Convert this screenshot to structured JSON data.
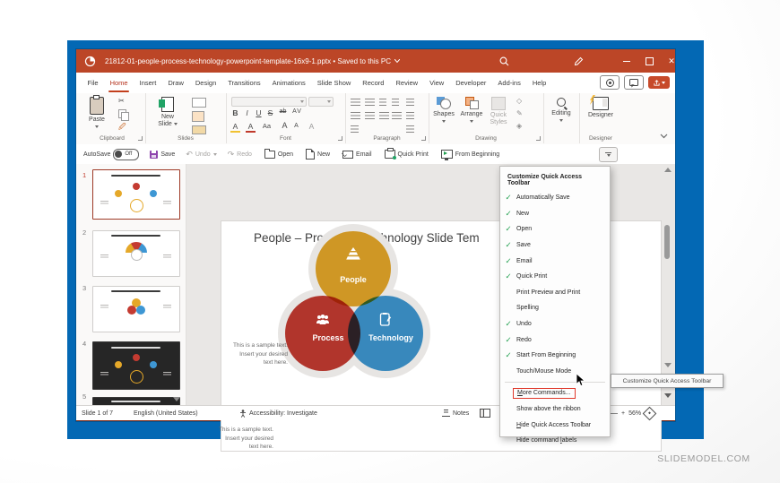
{
  "watermark": "SLIDEMODEL.COM",
  "colors": {
    "titlebar_red": "#BC4627",
    "desktop_blue": "#0368B4",
    "check_green": "#1E9E4C",
    "highlight_red": "#E0392C",
    "venn_people": "#E5A829",
    "venn_process": "#C43B31",
    "venn_technology": "#3E97D4"
  },
  "titlebar": {
    "title": "21812-01-people-process-technology-powerpoint-template-16x9-1.pptx • Saved to this PC"
  },
  "tabs": {
    "items": [
      "File",
      "Home",
      "Insert",
      "Draw",
      "Design",
      "Transitions",
      "Animations",
      "Slide Show",
      "Record",
      "Review",
      "View",
      "Developer",
      "Add-ins",
      "Help"
    ],
    "active": "Home"
  },
  "ribbon": {
    "clipboard": {
      "label": "Clipboard",
      "paste": "Paste"
    },
    "slides": {
      "label": "Slides",
      "new_slide_line1": "New",
      "new_slide_line2": "Slide"
    },
    "font": {
      "label": "Font",
      "bold": "B",
      "italic": "I",
      "underline": "U",
      "strike": "S",
      "strike_ab": "ab",
      "char_spacing": "AV",
      "highlight": "A",
      "font_color": "A",
      "change_case": "Aa",
      "grow_font": "A",
      "shrink_font": "A",
      "clear_format": "A"
    },
    "paragraph": {
      "label": "Paragraph"
    },
    "drawing": {
      "label": "Drawing",
      "shapes": "Shapes",
      "arrange": "Arrange",
      "quick_styles_line1": "Quick",
      "quick_styles_line2": "Styles"
    },
    "editing": {
      "label": "Editing"
    },
    "designer": {
      "label": "Designer",
      "button": "Designer"
    }
  },
  "qat": {
    "autosave": "AutoSave",
    "autosave_state": "Off",
    "save": "Save",
    "undo": "Undo",
    "redo": "Redo",
    "open": "Open",
    "new": "New",
    "email": "Email",
    "quick_print": "Quick Print",
    "from_beginning": "From Beginning"
  },
  "menu": {
    "header": "Customize Quick Access Toolbar",
    "items": [
      {
        "label": "Automatically Save",
        "checked": true
      },
      {
        "label": "New",
        "checked": true
      },
      {
        "label": "Open",
        "checked": true
      },
      {
        "label": "Save",
        "checked": true
      },
      {
        "label": "Email",
        "checked": true
      },
      {
        "label": "Quick Print",
        "checked": true
      },
      {
        "label": "Print Preview and Print",
        "checked": false
      },
      {
        "label": "Spelling",
        "checked": false
      },
      {
        "label": "Undo",
        "checked": true
      },
      {
        "label": "Redo",
        "checked": true
      },
      {
        "label": "Start From Beginning",
        "checked": true
      },
      {
        "label": "Touch/Mouse Mode",
        "checked": false
      }
    ],
    "footer": [
      {
        "pre": "",
        "key": "M",
        "post": "ore Commands...",
        "highlighted": true
      },
      {
        "pre": "Show above the ribbon",
        "key": "",
        "post": "",
        "highlighted": false
      },
      {
        "pre": "",
        "key": "H",
        "post": "ide Quick Access Toolbar",
        "highlighted": false
      },
      {
        "pre": "Hide command ",
        "key": "l",
        "post": "abels",
        "highlighted": false
      }
    ]
  },
  "tooltip": "Customize Quick Access Toolbar",
  "slide": {
    "title": "People – Process – Technology Slide Tem",
    "text_block_1": "This is a sample text.\nInsert your desired\ntext here.",
    "text_block_2": "This is a sample text.\nInsert your desired\ntext here.",
    "venn": {
      "people": "People",
      "process": "Process",
      "technology": "Technology"
    }
  },
  "thumbnails": {
    "numbers": [
      "1",
      "2",
      "3",
      "4",
      "5"
    ],
    "selected": "1"
  },
  "statusbar": {
    "slide_info": "Slide 1 of 7",
    "language": "English (United States)",
    "accessibility": "Accessibility: Investigate",
    "notes": "Notes",
    "zoom_level": "56%"
  }
}
